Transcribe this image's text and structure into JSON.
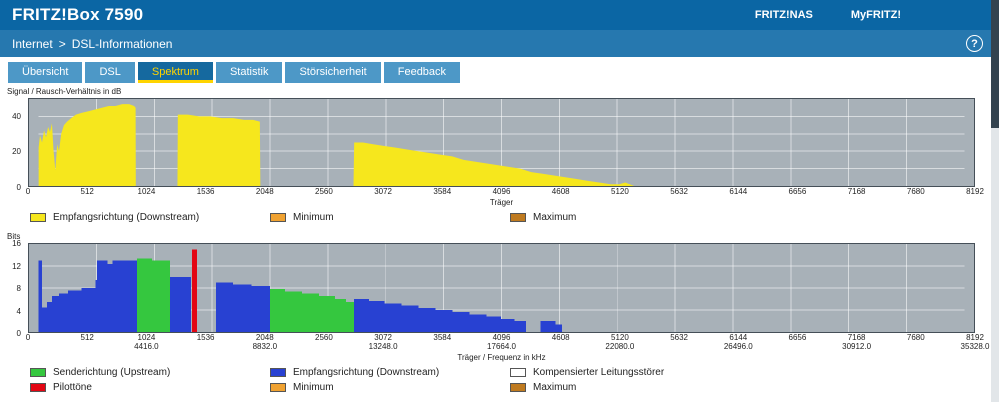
{
  "header": {
    "title": "FRITZ!Box 7590",
    "links": [
      {
        "label": "FRITZ!NAS"
      },
      {
        "label": "MyFRITZ!"
      }
    ]
  },
  "breadcrumb": {
    "items": [
      "Internet",
      "DSL-Informationen"
    ],
    "separator": ">"
  },
  "help_icon": "?",
  "tabs": [
    {
      "label": "Übersicht",
      "active": false
    },
    {
      "label": "DSL",
      "active": false
    },
    {
      "label": "Spektrum",
      "active": true
    },
    {
      "label": "Statistik",
      "active": false
    },
    {
      "label": "Störsicherheit",
      "active": false
    },
    {
      "label": "Feedback",
      "active": false
    }
  ],
  "colors": {
    "header_blue": "#0b66a4",
    "breadcrumb_blue": "#2678af",
    "tab_blue": "#4d98c7",
    "tab_active_blue": "#15699f",
    "accent_yellow": "#ffd400",
    "yellow": "#f6e71d",
    "blue": "#2841d2",
    "green": "#35c73f",
    "red": "#e30613",
    "white": "#ffffff",
    "minimum_orange": "#f0a231",
    "maximum_brown": "#bf7a1f",
    "plot_background": "#a8b1b8"
  },
  "chart_data": [
    {
      "type": "area",
      "title": "Signal / Rausch-Verhältnis in dB",
      "xlabel": "Träger",
      "xlim": [
        0,
        8192
      ],
      "ylim": [
        0,
        50
      ],
      "grid_y_step": 10,
      "y_ticks": [
        0,
        20,
        40
      ],
      "x_ticks": [
        {
          "tone": 0
        },
        {
          "tone": 512
        },
        {
          "tone": 1024
        },
        {
          "tone": 1536
        },
        {
          "tone": 2048
        },
        {
          "tone": 2560
        },
        {
          "tone": 3072
        },
        {
          "tone": 3584
        },
        {
          "tone": 4096
        },
        {
          "tone": 4608
        },
        {
          "tone": 5120
        },
        {
          "tone": 5632
        },
        {
          "tone": 6144
        },
        {
          "tone": 6656
        },
        {
          "tone": 7168
        },
        {
          "tone": 7680
        },
        {
          "tone": 8192
        }
      ],
      "series": [
        {
          "name": "Empfangsrichtung (Downstream)",
          "color": "#f6e71d",
          "points": [
            [
              0,
              22
            ],
            [
              12,
              29
            ],
            [
              30,
              25
            ],
            [
              48,
              32
            ],
            [
              66,
              28
            ],
            [
              84,
              34
            ],
            [
              100,
              31
            ],
            [
              118,
              36
            ],
            [
              132,
              20
            ],
            [
              148,
              9
            ],
            [
              164,
              24
            ],
            [
              180,
              20
            ],
            [
              200,
              30
            ],
            [
              224,
              35
            ],
            [
              252,
              37
            ],
            [
              288,
              39
            ],
            [
              330,
              41
            ],
            [
              380,
              42
            ],
            [
              440,
              43
            ],
            [
              500,
              44
            ],
            [
              560,
              45
            ],
            [
              620,
              46
            ],
            [
              680,
              46
            ],
            [
              740,
              47
            ],
            [
              800,
              47
            ],
            [
              845,
              46
            ],
            [
              858,
              45
            ],
            [
              860,
              0
            ],
            [
              1228,
              0
            ],
            [
              1232,
              41
            ],
            [
              1320,
              41
            ],
            [
              1420,
              40
            ],
            [
              1520,
              40
            ],
            [
              1620,
              39
            ],
            [
              1720,
              39
            ],
            [
              1820,
              38
            ],
            [
              1900,
              38
            ],
            [
              1958,
              37
            ],
            [
              1962,
              0
            ],
            [
              2786,
              0
            ],
            [
              2792,
              25
            ],
            [
              2870,
              25
            ],
            [
              2960,
              24
            ],
            [
              3060,
              23
            ],
            [
              3160,
              22
            ],
            [
              3260,
              21
            ],
            [
              3360,
              20
            ],
            [
              3460,
              19
            ],
            [
              3560,
              18
            ],
            [
              3660,
              17
            ],
            [
              3760,
              15
            ],
            [
              3860,
              14
            ],
            [
              3960,
              13
            ],
            [
              4060,
              12
            ],
            [
              4160,
              11
            ],
            [
              4260,
              10
            ],
            [
              4360,
              8
            ],
            [
              4460,
              7
            ],
            [
              4560,
              6
            ],
            [
              4660,
              5
            ],
            [
              4760,
              4
            ],
            [
              4860,
              3
            ],
            [
              4960,
              2
            ],
            [
              5060,
              1
            ],
            [
              5140,
              1
            ],
            [
              5190,
              2
            ],
            [
              5230,
              1
            ],
            [
              5270,
              0
            ],
            [
              8192,
              0
            ]
          ]
        }
      ],
      "legend_rows": [
        [
          {
            "label": "Empfangsrichtung (Downstream)",
            "color": "#f6e71d"
          },
          {
            "label": "Minimum",
            "color": "#f0a231"
          },
          {
            "label": "Maximum",
            "color": "#bf7a1f"
          }
        ]
      ]
    },
    {
      "type": "bar",
      "title": "Bits",
      "xlabel": "Träger / Frequenz in kHz",
      "xlim": [
        0,
        8192
      ],
      "ylim": [
        0,
        16
      ],
      "grid_y_step": 4,
      "y_ticks": [
        0,
        4,
        8,
        12,
        16
      ],
      "x_ticks": [
        {
          "tone": 0
        },
        {
          "tone": 512
        },
        {
          "tone": 1024,
          "freq": "4416.0"
        },
        {
          "tone": 1536
        },
        {
          "tone": 2048,
          "freq": "8832.0"
        },
        {
          "tone": 2560
        },
        {
          "tone": 3072,
          "freq": "13248.0"
        },
        {
          "tone": 3584
        },
        {
          "tone": 4096,
          "freq": "17664.0"
        },
        {
          "tone": 4608
        },
        {
          "tone": 5120,
          "freq": "22080.0"
        },
        {
          "tone": 5632
        },
        {
          "tone": 6144,
          "freq": "26496.0"
        },
        {
          "tone": 6656
        },
        {
          "tone": 7168,
          "freq": "30912.0"
        },
        {
          "tone": 7680
        },
        {
          "tone": 8192,
          "freq": "35328.0"
        }
      ],
      "segments": [
        [
          0,
          30,
          13,
          "blue"
        ],
        [
          30,
          75,
          4.5,
          "blue"
        ],
        [
          75,
          120,
          5.5,
          "blue"
        ],
        [
          120,
          180,
          6.5,
          "blue"
        ],
        [
          180,
          260,
          7,
          "blue"
        ],
        [
          260,
          380,
          7.5,
          "blue"
        ],
        [
          380,
          505,
          8,
          "blue"
        ],
        [
          505,
          518,
          9.5,
          "blue"
        ],
        [
          518,
          612,
          13,
          "blue"
        ],
        [
          612,
          655,
          12.4,
          "blue"
        ],
        [
          655,
          872,
          13,
          "blue"
        ],
        [
          872,
          1005,
          13.4,
          "green"
        ],
        [
          1005,
          1162,
          13,
          "green"
        ],
        [
          1162,
          1348,
          10,
          "blue"
        ],
        [
          1357,
          1402,
          15,
          "red"
        ],
        [
          1572,
          1722,
          9,
          "blue"
        ],
        [
          1722,
          1882,
          8.6,
          "blue"
        ],
        [
          1882,
          2046,
          8.4,
          "blue"
        ],
        [
          2046,
          2182,
          7.8,
          "green"
        ],
        [
          2182,
          2332,
          7.4,
          "green"
        ],
        [
          2332,
          2482,
          7,
          "green"
        ],
        [
          2482,
          2622,
          6.5,
          "green"
        ],
        [
          2622,
          2722,
          6,
          "green"
        ],
        [
          2722,
          2790,
          5.5,
          "green"
        ],
        [
          2790,
          2922,
          6,
          "blue"
        ],
        [
          2922,
          3062,
          5.6,
          "blue"
        ],
        [
          3062,
          3212,
          5.2,
          "blue"
        ],
        [
          3212,
          3362,
          4.8,
          "blue"
        ],
        [
          3362,
          3512,
          4.4,
          "blue"
        ],
        [
          3512,
          3662,
          4,
          "blue"
        ],
        [
          3662,
          3812,
          3.6,
          "blue"
        ],
        [
          3812,
          3962,
          3.2,
          "blue"
        ],
        [
          3962,
          4092,
          2.8,
          "blue"
        ],
        [
          4092,
          4212,
          2.4,
          "blue"
        ],
        [
          4212,
          4312,
          2,
          "blue"
        ],
        [
          4440,
          4572,
          2,
          "blue"
        ],
        [
          4572,
          4632,
          1.4,
          "blue"
        ]
      ],
      "legend_rows": [
        [
          {
            "label": "Senderichtung (Upstream)",
            "color": "#35c73f"
          },
          {
            "label": "Empfangsrichtung (Downstream)",
            "color": "#2841d2"
          },
          {
            "label": "Kompensierter Leitungsstörer",
            "color": "#ffffff"
          }
        ],
        [
          {
            "label": "Pilottöne",
            "color": "#e30613"
          },
          {
            "label": "Minimum",
            "color": "#f0a231"
          },
          {
            "label": "Maximum",
            "color": "#bf7a1f"
          }
        ]
      ]
    }
  ]
}
